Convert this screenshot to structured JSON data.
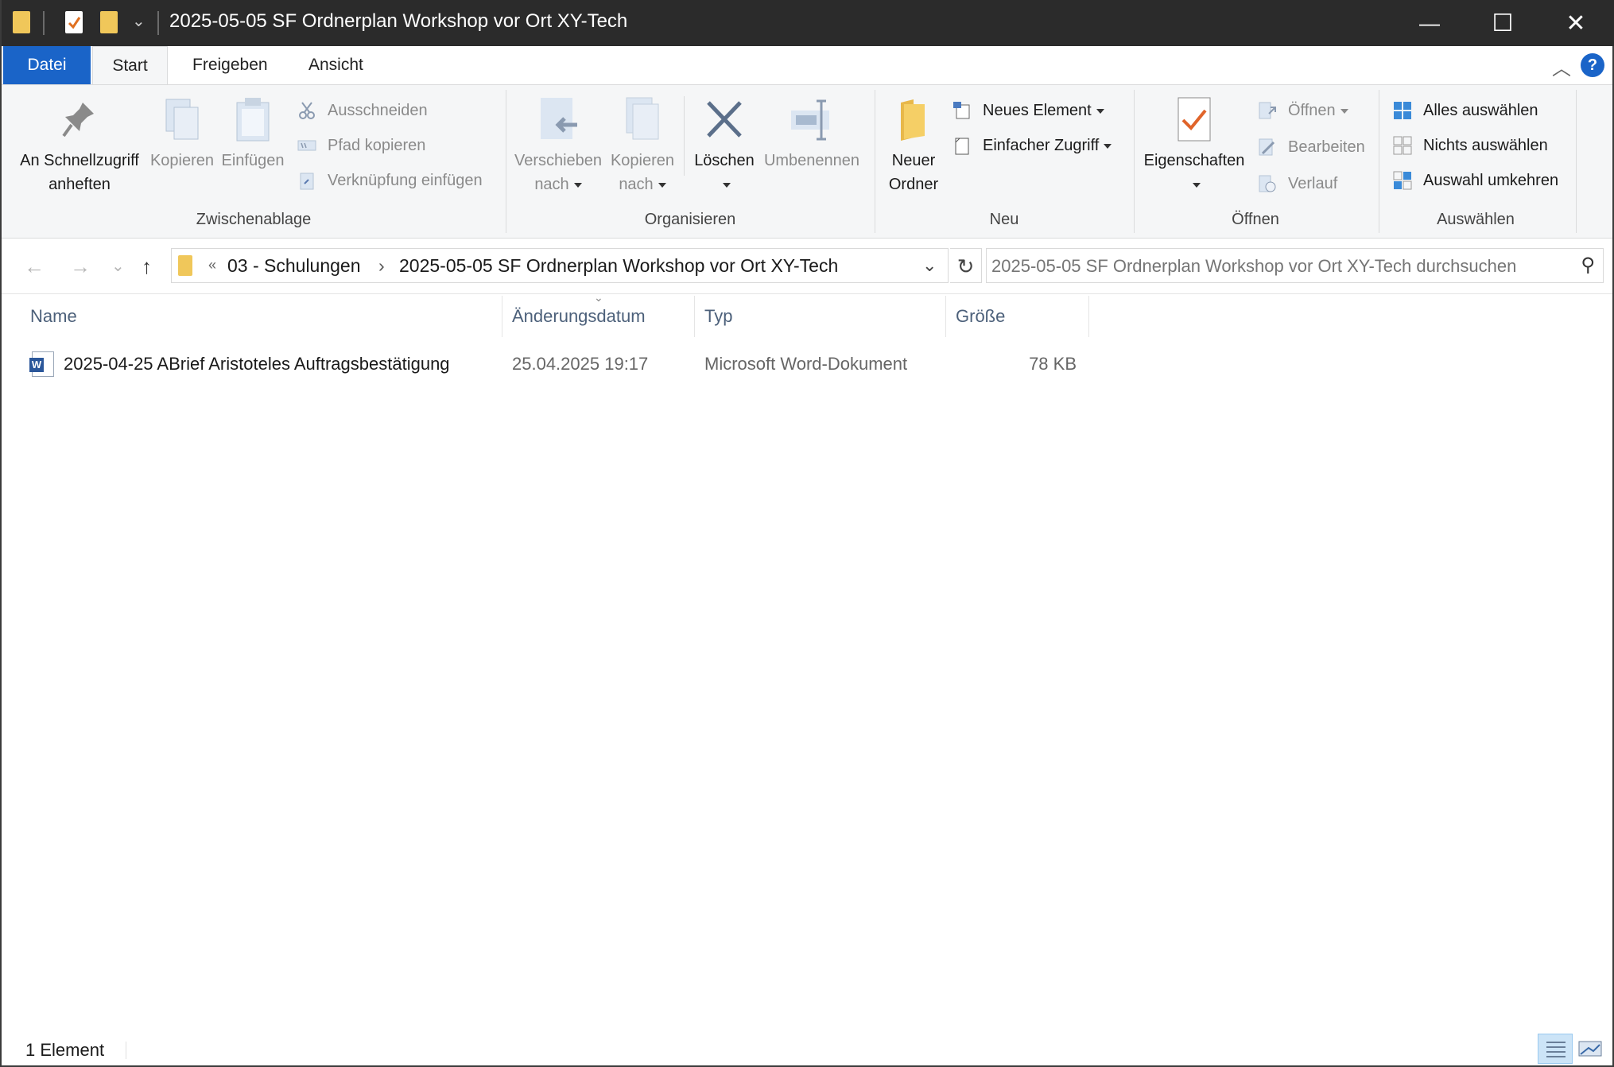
{
  "window": {
    "title": "2025-05-05 SF Ordnerplan Workshop vor Ort XY-Tech",
    "qat_dropdown": "⌄",
    "minimize": "—",
    "maximize": "☐",
    "close": "✕"
  },
  "tabs": {
    "file": "Datei",
    "start": "Start",
    "share": "Freigeben",
    "view": "Ansicht",
    "help": "?",
    "collapse": "︿"
  },
  "ribbon": {
    "clipboard": {
      "label": "Zwischenablage",
      "pin_line1": "An Schnellzugriff",
      "pin_line2": "anheften",
      "copy": "Kopieren",
      "paste": "Einfügen",
      "cut": "Ausschneiden",
      "copy_path": "Pfad kopieren",
      "paste_shortcut": "Verknüpfung einfügen"
    },
    "organize": {
      "label": "Organisieren",
      "move_line1": "Verschieben",
      "move_line2": "nach",
      "copyto_line1": "Kopieren",
      "copyto_line2": "nach",
      "delete": "Löschen",
      "rename": "Umbenennen"
    },
    "new": {
      "label": "Neu",
      "new_folder_line1": "Neuer",
      "new_folder_line2": "Ordner",
      "new_item": "Neues Element",
      "easy_access": "Einfacher Zugriff"
    },
    "open": {
      "label": "Öffnen",
      "properties": "Eigenschaften",
      "open": "Öffnen",
      "edit": "Bearbeiten",
      "history": "Verlauf"
    },
    "select": {
      "label": "Auswählen",
      "select_all": "Alles auswählen",
      "select_none": "Nichts auswählen",
      "invert": "Auswahl umkehren"
    }
  },
  "address": {
    "back": "←",
    "forward": "→",
    "recent": "⌄",
    "up": "↑",
    "overflow": "«",
    "crumb1": "03 - Schulungen",
    "sep": "›",
    "crumb2": "2025-05-05 SF Ordnerplan Workshop vor Ort XY-Tech",
    "dropdown": "⌄",
    "refresh": "↻",
    "search_placeholder": "2025-05-05 SF Ordnerplan Workshop vor Ort XY-Tech durchsuchen",
    "search_icon": "⚲"
  },
  "columns": {
    "name": "Name",
    "date": "Änderungsdatum",
    "type": "Typ",
    "size": "Größe",
    "sort": "⌄"
  },
  "files": [
    {
      "name": "2025-04-25 ABrief Aristoteles Auftragsbestätigung",
      "date": "25.04.2025 19:17",
      "type": "Microsoft Word-Dokument",
      "size": "78 KB",
      "icon": "word-doc-icon",
      "icon_letter": "W"
    }
  ],
  "status": {
    "count": "1 Element"
  }
}
